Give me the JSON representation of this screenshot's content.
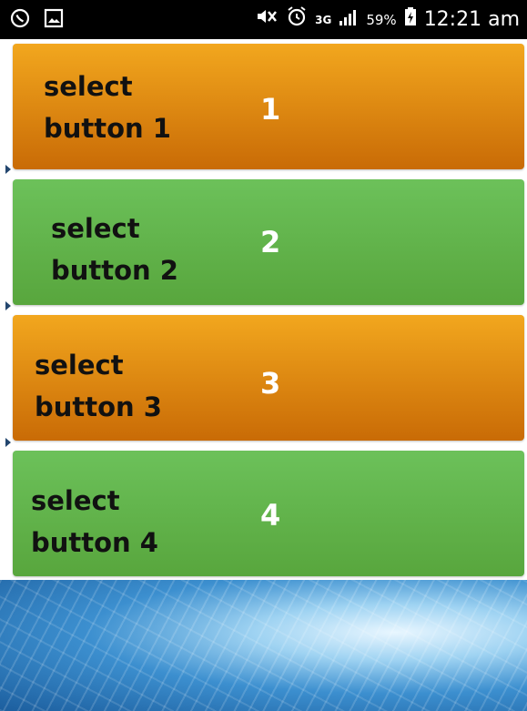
{
  "status_bar": {
    "left_icons": [
      "whatsapp-icon",
      "gallery-icon"
    ],
    "right_icons": [
      "mute-icon",
      "alarm-icon",
      "3g-icon",
      "signal-icon",
      "battery-icon"
    ],
    "network": "3G",
    "battery_percent": "59%",
    "time": "12:21 am"
  },
  "buttons": [
    {
      "label": "select\nbutton 1",
      "number": "1",
      "color": "#e08d12"
    },
    {
      "label": "select\nbutton 2",
      "number": "2",
      "color": "#62b44b"
    },
    {
      "label": "select\nbutton 3",
      "number": "3",
      "color": "#e08d12"
    },
    {
      "label": "select\nbutton 4",
      "number": "4",
      "color": "#62b44b"
    }
  ]
}
